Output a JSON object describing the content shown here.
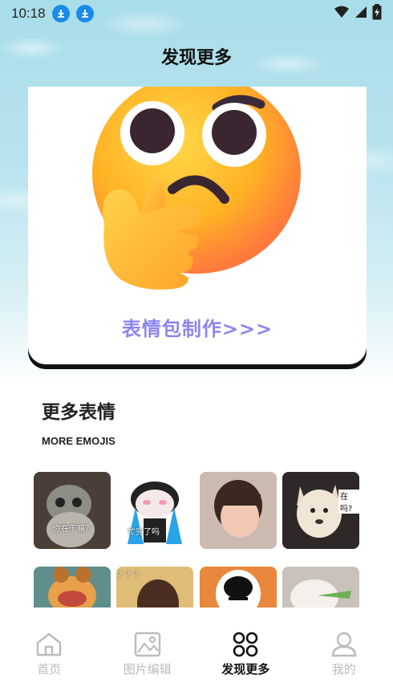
{
  "status_bar": {
    "time": "10:18"
  },
  "header": {
    "title": "发现更多"
  },
  "banner": {
    "caption": "表情包制作>>>"
  },
  "section": {
    "title": "更多表情",
    "subtitle": "MORE EMOJIS"
  },
  "emojis": [
    {
      "caption": "你在干嘛？"
    },
    {
      "caption": "忙完了吗"
    },
    {
      "caption": ""
    },
    {
      "caption": "在吗?"
    },
    {
      "caption": ""
    },
    {
      "caption": "？？？"
    },
    {
      "caption": ""
    },
    {
      "caption": ""
    }
  ],
  "nav": {
    "items": [
      {
        "label": "首页"
      },
      {
        "label": "图片编辑"
      },
      {
        "label": "发现更多"
      },
      {
        "label": "我的"
      }
    ],
    "active_color": "#111111",
    "inactive_color": "#bbbbbb"
  }
}
